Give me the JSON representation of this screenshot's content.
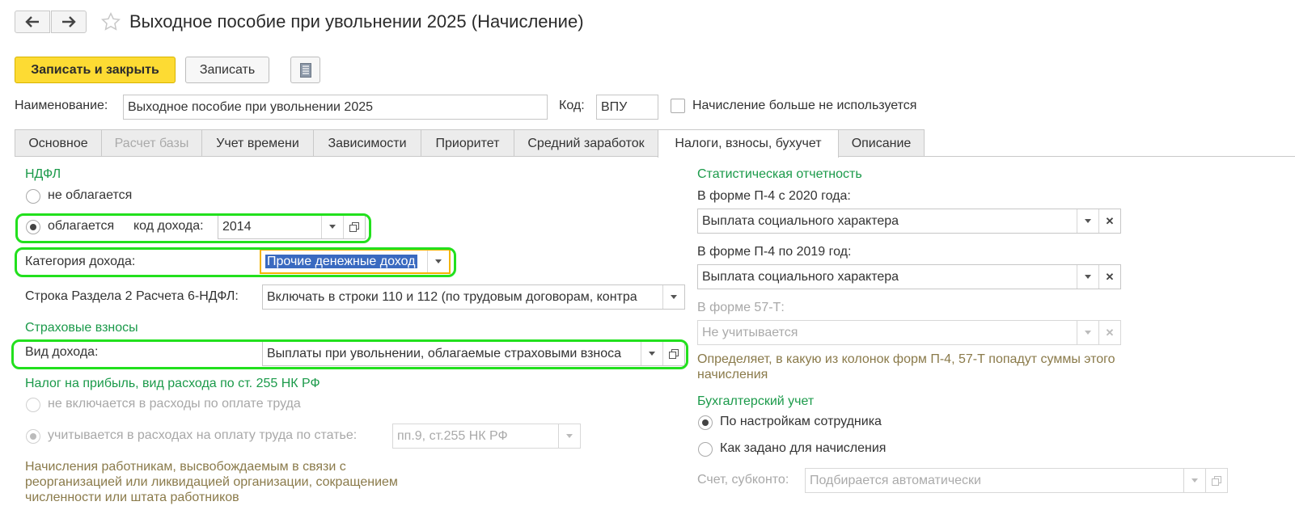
{
  "header": {
    "title": "Выходное пособие при увольнении 2025 (Начисление)",
    "back_icon": "arrow-left",
    "forward_icon": "arrow-right",
    "favorite_icon": "star-outline"
  },
  "toolbar": {
    "save_close_label": "Записать и закрыть",
    "save_label": "Записать",
    "doc_icon": "document-list"
  },
  "top_fields": {
    "name_label": "Наименование:",
    "name_value": "Выходное пособие при увольнении 2025",
    "code_label": "Код:",
    "code_value": "ВПУ",
    "unused_label": "Начисление больше не используется",
    "unused_checked": false
  },
  "tabs": [
    {
      "label": "Основное",
      "state": "normal"
    },
    {
      "label": "Расчет базы",
      "state": "disabled"
    },
    {
      "label": "Учет времени",
      "state": "normal"
    },
    {
      "label": "Зависимости",
      "state": "normal"
    },
    {
      "label": "Приоритет",
      "state": "normal"
    },
    {
      "label": "Средний заработок",
      "state": "normal"
    },
    {
      "label": "Налоги, взносы, бухучет",
      "state": "active"
    },
    {
      "label": "Описание",
      "state": "normal"
    }
  ],
  "ndfl": {
    "section": "НДФЛ",
    "not_taxed": "не облагается",
    "taxed": "облагается",
    "income_code_label": "код дохода:",
    "income_code_value": "2014",
    "category_label": "Категория дохода:",
    "category_value": "Прочие денежные доход",
    "row6_label": "Строка Раздела 2 Расчета 6-НДФЛ:",
    "row6_value": "Включать в строки 110 и 112 (по трудовым договорам, контра"
  },
  "insurance": {
    "section": "Страховые взносы",
    "income_type_label": "Вид дохода:",
    "income_type_value": "Выплаты при увольнении, облагаемые страховыми взноса"
  },
  "profit_tax": {
    "section": "Налог на прибыль, вид расхода по ст. 255 НК РФ",
    "option_not_included": "не включается в расходы по оплате труда",
    "option_included": "учитывается в расходах на оплату труда по статье:",
    "article_value": "пп.9, ст.255 НК РФ",
    "note": "Начисления работникам, высвобождаемым в связи с реорганизацией или ликвидацией организации, сокращением численности или штата работников"
  },
  "statistics": {
    "section": "Статистическая отчетность",
    "p4_2020_label": "В форме П-4 с 2020 года:",
    "p4_2020_value": "Выплата социального характера",
    "p4_2019_label": "В форме П-4 по 2019 год:",
    "p4_2019_value": "Выплата социального характера",
    "f57t_label": "В форме 57-Т:",
    "f57t_value": "Не учитывается",
    "note": "Определяет, в какую из колонок форм П-4, 57-Т попадут суммы этого начисления"
  },
  "accounting": {
    "section": "Бухгалтерский учет",
    "option_employee": "По настройкам сотрудника",
    "option_accrual": "Как задано для начисления",
    "account_label": "Счет, субконто:",
    "account_value": "Подбирается автоматически"
  },
  "colors": {
    "section_green": "#1b9a4a",
    "note_brown": "#8a7a4a",
    "highlight_green": "#22e01d",
    "primary_yellow": "#fddb33"
  }
}
